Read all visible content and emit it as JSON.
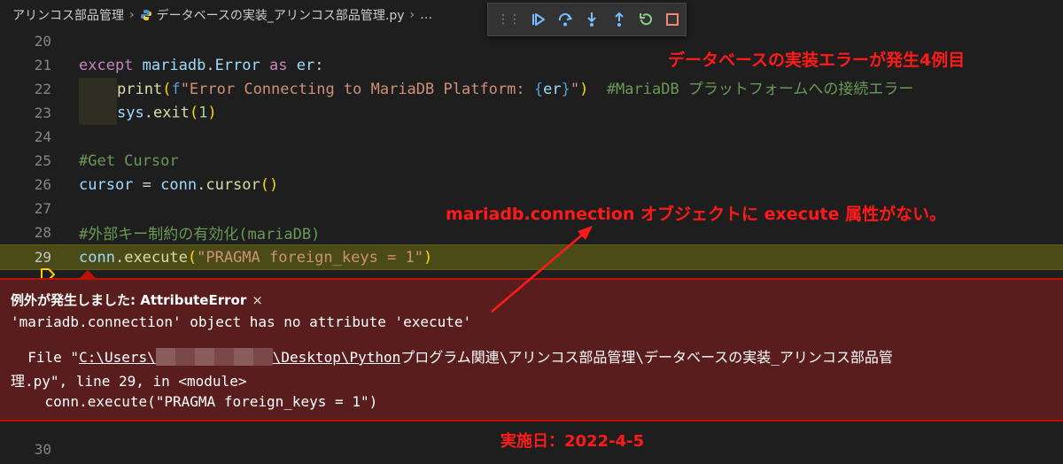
{
  "breadcrumb": {
    "folder": "アリンコス部品管理",
    "file": "データベースの実装_アリンコス部品管理.py",
    "more": "…"
  },
  "debug_toolbar": {
    "buttons": [
      {
        "name": "continue-icon",
        "tooltip": "Continue"
      },
      {
        "name": "step-over-icon",
        "tooltip": "Step Over"
      },
      {
        "name": "step-into-icon",
        "tooltip": "Step Into"
      },
      {
        "name": "step-out-icon",
        "tooltip": "Step Out"
      },
      {
        "name": "restart-icon",
        "tooltip": "Restart"
      },
      {
        "name": "stop-icon",
        "tooltip": "Stop"
      }
    ],
    "colors": {
      "blue": "#75beff",
      "green": "#89d185",
      "red": "#f48771"
    }
  },
  "editor": {
    "lines": {
      "l20": {
        "num": "20"
      },
      "l21": {
        "num": "21",
        "kw_except": "except",
        "mod": " mariadb",
        "dot": ".",
        "cls": "Error",
        "kw_as": " as ",
        "var": "er",
        "colon": ":"
      },
      "l22": {
        "num": "22",
        "fn": "print",
        "p_open": "(",
        "prefix": "f",
        "str1": "\"Error Connecting to MariaDB Platform: ",
        "b_open": "{",
        "var": "er",
        "b_close": "}",
        "str2": "\"",
        "p_close": ")",
        "comment": "  #MariaDB プラットフォームへの接続エラー"
      },
      "l23": {
        "num": "23",
        "mod": "sys",
        "dot": ".",
        "fn": "exit",
        "p_open": "(",
        "arg": "1",
        "p_close": ")"
      },
      "l24": {
        "num": "24"
      },
      "l25": {
        "num": "25",
        "comment": "#Get Cursor"
      },
      "l26": {
        "num": "26",
        "var": "cursor",
        "eq": " = ",
        "obj": "conn",
        "dot": ".",
        "fn": "cursor",
        "parens": "()"
      },
      "l27": {
        "num": "27"
      },
      "l28": {
        "num": "28",
        "comment": "#外部キー制約の有効化(mariaDB)"
      },
      "l29": {
        "num": "29",
        "obj": "conn",
        "dot": ".",
        "fn": "execute",
        "p_open": "(",
        "str": "\"PRAGMA foreign_keys = 1\"",
        "p_close": ")"
      },
      "l30": {
        "num": "30"
      }
    }
  },
  "exception": {
    "title": "例外が発生しました: AttributeError",
    "close": "×",
    "message": "'mariadb.connection' object has no attribute 'execute'",
    "trace": {
      "file_prefix": "  File \"",
      "path_part1": "C:\\Users\\",
      "path_part2": "\\Desktop\\Python",
      "path_rest": "プログラム関連\\アリンコス部品管理\\データベースの実装_アリンコス部品管",
      "line2": "理.py\", line 29, in <module>",
      "line3": "    conn.execute(\"PRAGMA foreign_keys = 1\")"
    }
  },
  "annotations": {
    "top_right": "データベースの実装エラーが発生4例目",
    "middle": "mariadb.connection オブジェクトに execute 属性がない。",
    "date": "実施日：2022-4-5",
    "color": "#ff1a1a"
  }
}
